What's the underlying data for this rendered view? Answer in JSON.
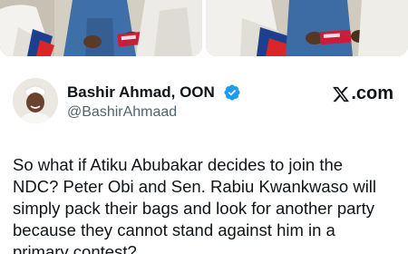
{
  "author": {
    "display_name": "Bashir Ahmad, OON",
    "handle": "@BashirAhmaad",
    "verified": true
  },
  "source": {
    "label": ".com",
    "logo_icon": "x-logo-icon"
  },
  "tweet": {
    "text": "So what if Atiku Abubakar decides to join the\nNDC? Peter Obi and Sen. Rabiu Kwankwaso will\nsimply pack their bags and look for another party\nbecause they cannot stand against him in a\nprimary contest?"
  },
  "colors": {
    "text_primary": "#0f1419",
    "text_secondary": "#536471",
    "verified_blue": "#1d9bf0"
  }
}
